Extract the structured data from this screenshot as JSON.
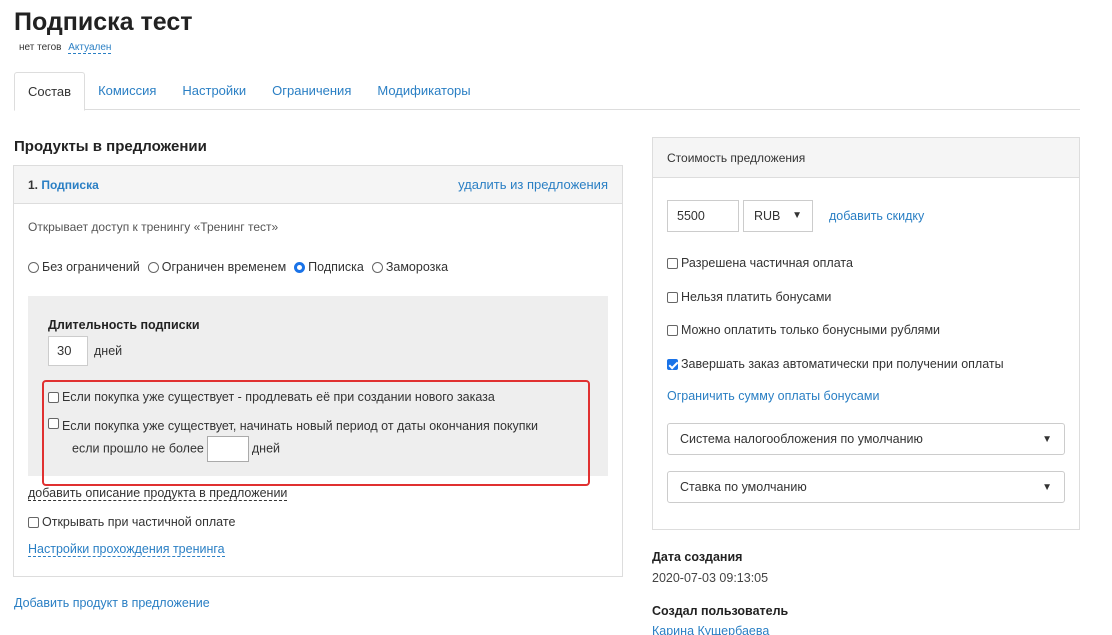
{
  "header": {
    "title": "Подписка тест",
    "no_tags": "нет тегов",
    "status": "Актуален"
  },
  "tabs": [
    {
      "label": "Состав",
      "active": true
    },
    {
      "label": "Комиссия"
    },
    {
      "label": "Настройки"
    },
    {
      "label": "Ограничения"
    },
    {
      "label": "Модификаторы"
    }
  ],
  "products": {
    "section_title": "Продукты в предложении",
    "item": {
      "number": "1.",
      "name": "Подписка",
      "remove_label": "удалить из предложения",
      "description": "Открывает доступ к тренингу «Тренинг тест»",
      "access_options": [
        {
          "label": "Без ограничений",
          "checked": false
        },
        {
          "label": "Ограничен временем",
          "checked": false
        },
        {
          "label": "Подписка",
          "checked": true
        },
        {
          "label": "Заморозка",
          "checked": false
        }
      ],
      "subscription": {
        "title": "Длительность подписки",
        "duration_value": "30",
        "duration_unit": "дней",
        "extend_label": "Если покупка уже существует - продлевать её при создании нового заказа",
        "new_period_label_1": "Если покупка уже существует, начинать новый период от даты окончания покупки",
        "new_period_label_2": "если прошло не более",
        "new_period_days_value": "",
        "new_period_unit": "дней"
      },
      "add_description_label": "добавить описание продукта в предложении",
      "open_on_partial_label": "Открывать при частичной оплате",
      "training_settings_label": "Настройки прохождения тренинга"
    },
    "add_product_label": "Добавить продукт в предложение"
  },
  "price": {
    "header": "Стоимость предложения",
    "amount": "5500",
    "currency": "RUB",
    "add_discount_label": "добавить скидку",
    "options": [
      {
        "label": "Разрешена частичная оплата",
        "checked": false
      },
      {
        "label": "Нельзя платить бонусами",
        "checked": false
      },
      {
        "label": "Можно оплатить только бонусными рублями",
        "checked": false
      },
      {
        "label": "Завершать заказ автоматически при получении оплаты",
        "checked": true
      }
    ],
    "limit_bonus_label": "Ограничить сумму оплаты бонусами",
    "tax_system": "Система налогообложения по умолчанию",
    "tax_rate": "Ставка по умолчанию"
  },
  "meta": {
    "created_label": "Дата создания",
    "created_value": "2020-07-03 09:13:05",
    "creator_label": "Создал пользователь",
    "creator_value": "Карина Кущербаева"
  },
  "colors": {
    "link": "#2a7fc4",
    "highlight": "#e03030",
    "checkbox_checked": "#1a73e8"
  }
}
